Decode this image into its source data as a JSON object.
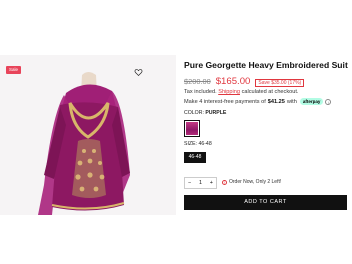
{
  "product": {
    "sale_badge": "Sale",
    "title": "Pure Georgette Heavy Embroidered Suit",
    "old_price": "$200.00",
    "new_price": "$165.00",
    "save_label": "Save $35.00 (17%)",
    "tax_prefix": "Tax included.",
    "tax_link": "Shipping",
    "tax_suffix": "calculated at checkout.",
    "installment_prefix": "Make 4 interest-free payments of",
    "installment_amount": "$41.25",
    "installment_suffix": "with",
    "afterpay_label": "afterpay",
    "info_icon_label": "i",
    "color_heading": "COLOR:",
    "color_value": "PURPLE",
    "size_heading": "SIZE:",
    "size_value": "46-48",
    "sizes": [
      "46-48"
    ],
    "quantity": "1",
    "qty_minus": "−",
    "qty_plus": "+",
    "stock_note": "Order Now, Only 2 Left!",
    "add_to_cart": "ADD TO CART"
  },
  "colors": {
    "accent_red": "#e0373f",
    "sale_badge": "#e8445a",
    "button_bg": "#111111",
    "afterpay_bg": "#b2fce4",
    "swatch_purple": "#9b1f6f"
  },
  "icons": {
    "wishlist": "heart-outline-icon",
    "info": "info-circle-icon",
    "stock_warning": "alert-circle-icon"
  }
}
